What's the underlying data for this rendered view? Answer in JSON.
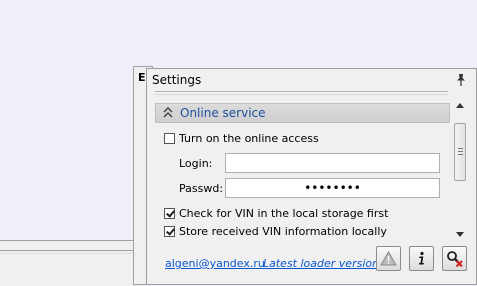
{
  "background_window": {
    "title": "E"
  },
  "settings": {
    "title": "Settings",
    "group": {
      "label": "Online service"
    },
    "online_access": {
      "label": "Turn on the online access",
      "checked": false
    },
    "login": {
      "label": "Login:",
      "value": ""
    },
    "passwd": {
      "label": "Passwd:",
      "value": "••••••••"
    },
    "check_vin": {
      "label": "Check for VIN in the local storage first",
      "checked": true
    },
    "store_vin": {
      "label": "Store received VIN information locally",
      "checked": true
    }
  },
  "footer": {
    "email_link": "algeni@yandex.ru",
    "loader_link": "Latest loader version"
  },
  "icons": {
    "pin": "pin-icon",
    "warning": "warning-icon",
    "info": "info-icon",
    "search_remove": "search-remove-icon"
  }
}
